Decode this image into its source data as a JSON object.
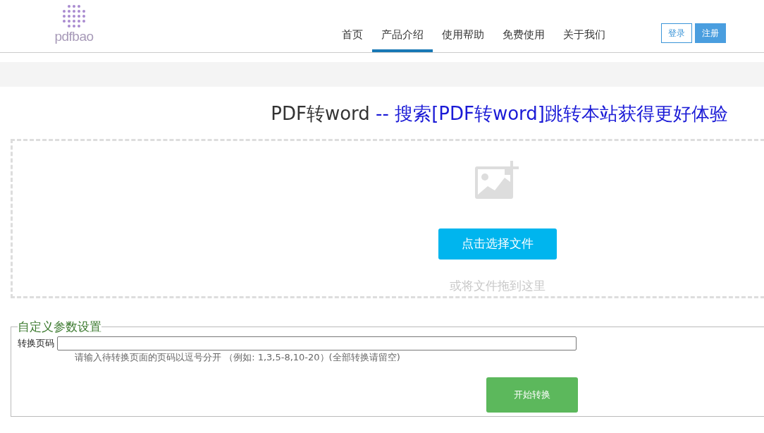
{
  "logo": {
    "text": "pdfbao"
  },
  "nav": [
    {
      "label": "首页",
      "selected": false
    },
    {
      "label": "产品介绍",
      "selected": true
    },
    {
      "label": "使用帮助",
      "selected": false
    },
    {
      "label": "免费使用",
      "selected": false
    },
    {
      "label": "关于我们",
      "selected": false
    }
  ],
  "auth": {
    "login": "登录",
    "register": "注册"
  },
  "heading": {
    "title": "PDF转word",
    "link": "-- 搜索[PDF转word]跳转本站获得更好体验"
  },
  "upload": {
    "button": "点击选择文件",
    "hint": "或将文件拖到这里"
  },
  "settings": {
    "legend": "自定义参数设置",
    "field_label": "转换页码",
    "help": "请输入待转换页面的页码以逗号分开 （例如: 1,3,5-8,10-20）(全部转换请留空)",
    "submit": "开始转换"
  }
}
